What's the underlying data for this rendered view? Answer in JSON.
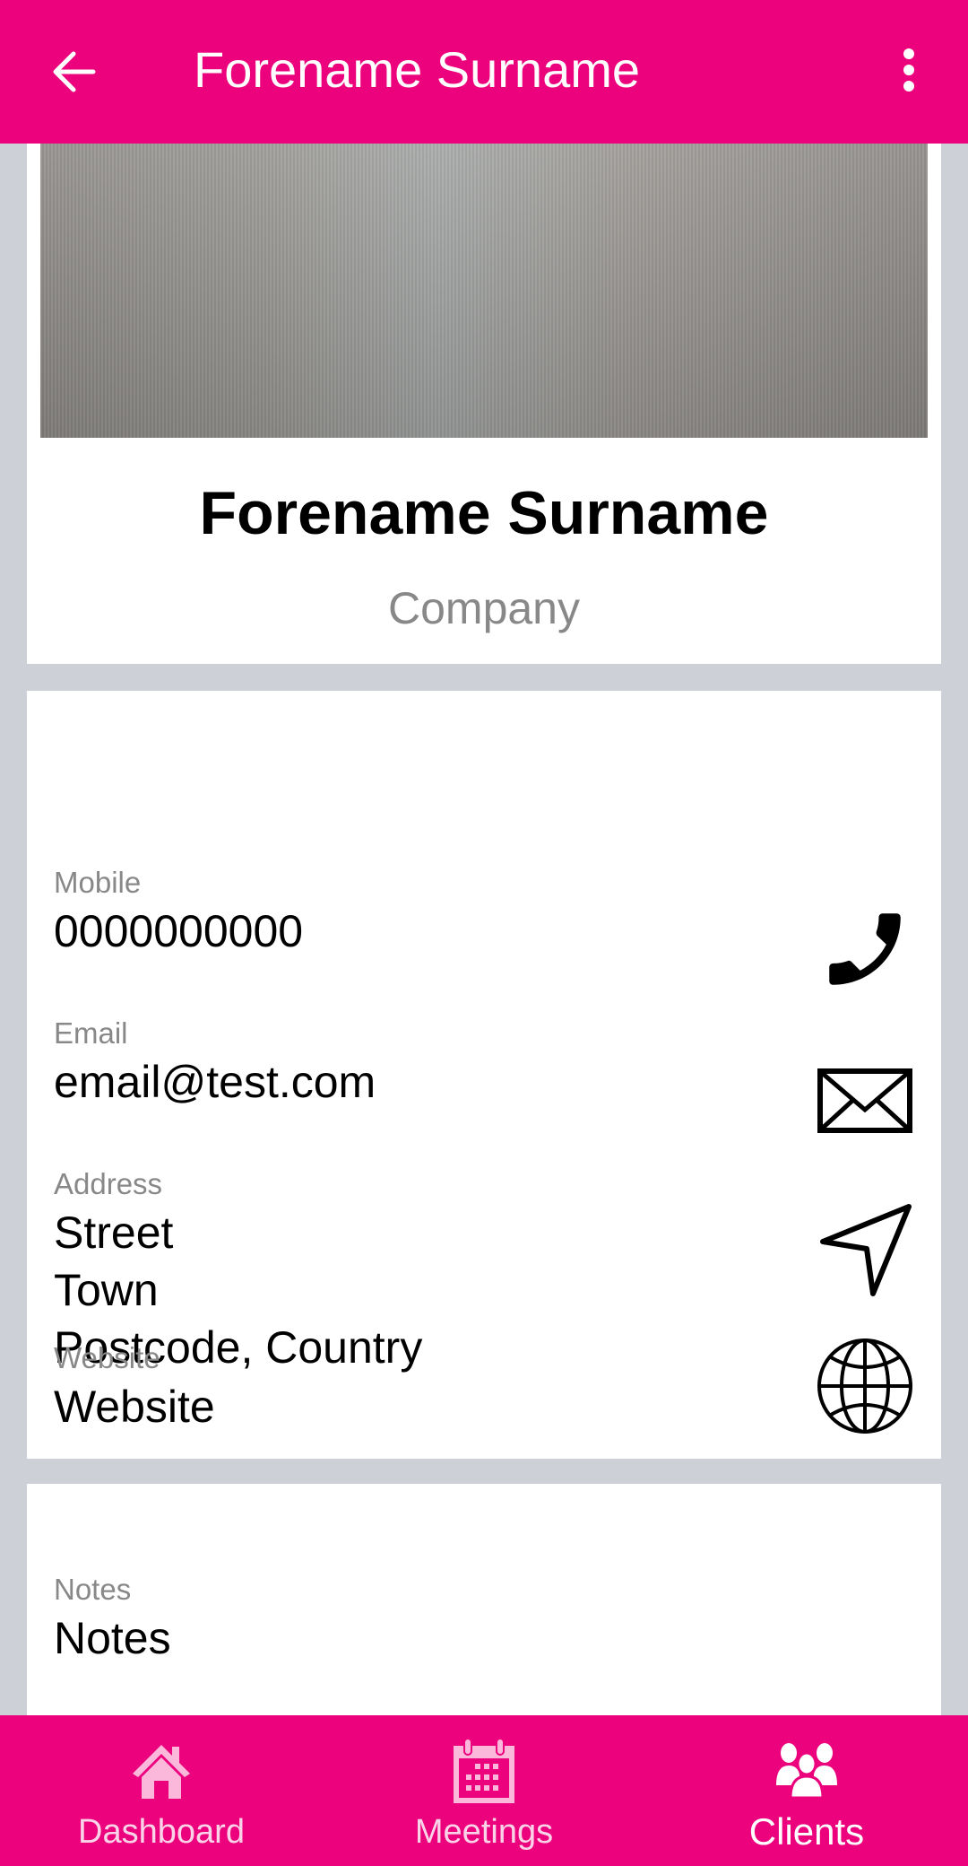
{
  "colors": {
    "primary": "#ec027d",
    "background": "#cdd0d7",
    "label_grey": "#888888",
    "nav_inactive": "#fbb8da",
    "nav_active": "#ffffff"
  },
  "appbar": {
    "back_icon": "arrow-left-icon",
    "title": "Forename Surname",
    "menu_icon": "more-vertical-icon"
  },
  "profile": {
    "photo": "profile-photo",
    "name": "Forename Surname",
    "company": "Company"
  },
  "contact": {
    "mobile": {
      "label": "Mobile",
      "value": "0000000000",
      "action_icon": "phone-icon"
    },
    "email": {
      "label": "Email",
      "value": "email@test.com",
      "action_icon": "envelope-icon"
    },
    "address": {
      "label": "Address",
      "lines": [
        "Street",
        "Town",
        "Postcode, Country"
      ],
      "action_icon": "navigation-arrow-icon"
    },
    "website": {
      "label": "Website",
      "value": "Website",
      "action_icon": "globe-icon"
    }
  },
  "notes": {
    "label": "Notes",
    "value": "Notes"
  },
  "bottom_nav": {
    "items": [
      {
        "label": "Dashboard",
        "icon": "home-icon",
        "active": false
      },
      {
        "label": "Meetings",
        "icon": "calendar-icon",
        "active": false
      },
      {
        "label": "Clients",
        "icon": "users-icon",
        "active": true
      }
    ]
  }
}
